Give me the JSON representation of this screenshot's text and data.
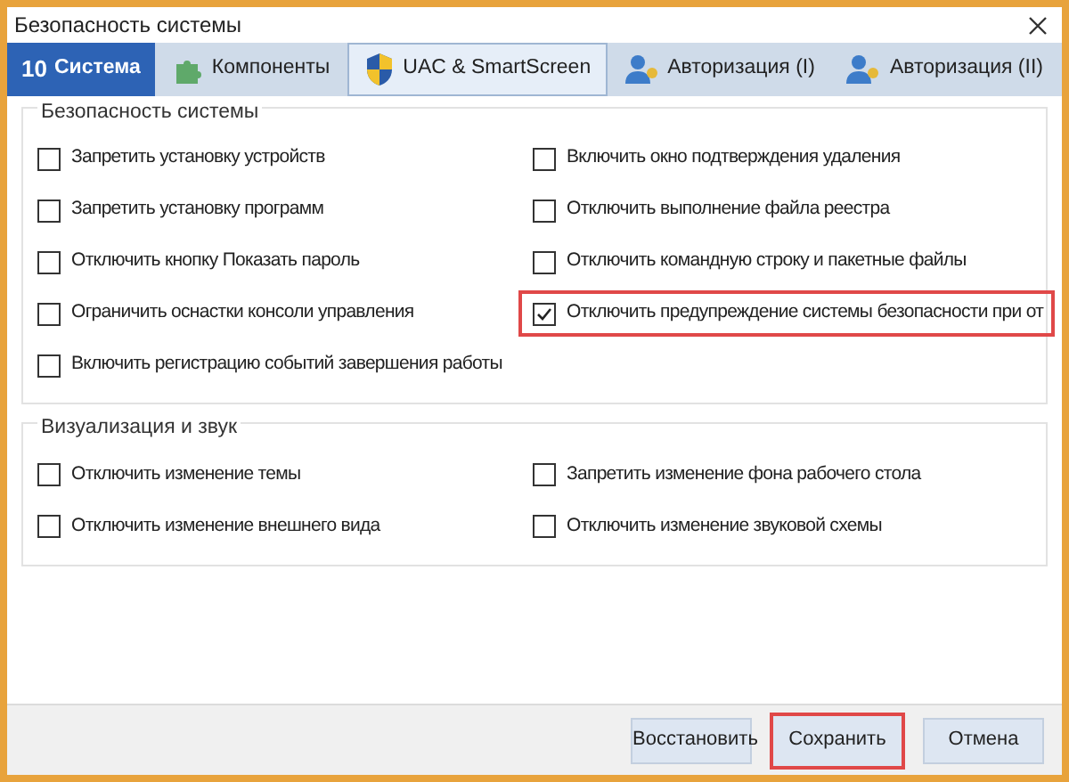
{
  "window": {
    "title": "Безопасность системы"
  },
  "tabs": [
    {
      "label": "Система",
      "badge": "10",
      "selected": true
    },
    {
      "label": "Компоненты",
      "selected": false
    },
    {
      "label": "UAC & SmartScreen",
      "selected": false
    },
    {
      "label": "Авторизация (I)",
      "selected": false
    },
    {
      "label": "Авторизация (II)",
      "selected": false
    }
  ],
  "groups": [
    {
      "title": "Безопасность системы",
      "columns": [
        [
          {
            "label": "Запретить установку устройств",
            "checked": false,
            "highlighted": false
          },
          {
            "label": "Запретить установку программ",
            "checked": false,
            "highlighted": false
          },
          {
            "label": "Отключить кнопку Показать пароль",
            "checked": false,
            "highlighted": false
          },
          {
            "label": "Ограничить оснастки консоли управления",
            "checked": false,
            "highlighted": false
          },
          {
            "label": "Включить регистрацию событий завершения работы",
            "checked": false,
            "highlighted": false
          }
        ],
        [
          {
            "label": "Включить окно подтверждения удаления",
            "checked": false,
            "highlighted": false
          },
          {
            "label": "Отключить выполнение файла реестра",
            "checked": false,
            "highlighted": false
          },
          {
            "label": "Отключить командную строку и пакетные файлы",
            "checked": false,
            "highlighted": false
          },
          {
            "label": "Отключить предупреждение системы безопасности при от",
            "checked": true,
            "highlighted": true
          }
        ]
      ]
    },
    {
      "title": "Визуализация и звук",
      "columns": [
        [
          {
            "label": "Отключить изменение темы",
            "checked": false,
            "highlighted": false
          },
          {
            "label": "Отключить изменение внешнего вида",
            "checked": false,
            "highlighted": false
          }
        ],
        [
          {
            "label": "Запретить изменение фона рабочего стола",
            "checked": false,
            "highlighted": false
          },
          {
            "label": "Отключить изменение звуковой схемы",
            "checked": false,
            "highlighted": false
          }
        ]
      ]
    }
  ],
  "buttons": [
    {
      "label": "Восстановить",
      "highlighted": false
    },
    {
      "label": "Сохранить",
      "highlighted": true
    },
    {
      "label": "Отмена",
      "highlighted": false
    }
  ]
}
